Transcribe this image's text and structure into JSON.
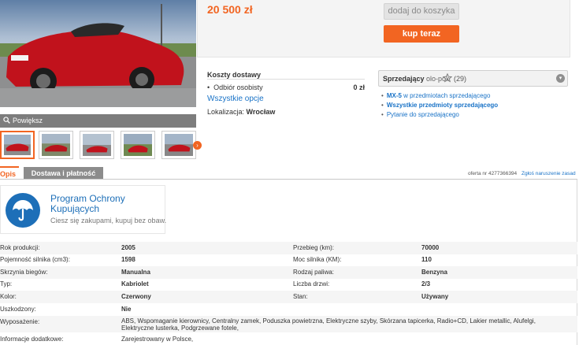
{
  "gallery": {
    "zoom_label": "Powiększ",
    "thumb_count": 5
  },
  "offer": {
    "price": "20 500 zł",
    "add_to_cart_label": "dodaj do koszyka",
    "buy_now_label": "kup teraz"
  },
  "shipping": {
    "title": "Koszty dostawy",
    "rows": [
      {
        "bullet": "•",
        "label": "Odbiór osobisty",
        "value": "0 zł"
      }
    ],
    "all_options_label": "Wszystkie opcje",
    "location_label": "Lokalizacja:",
    "location_value": "Wrocław"
  },
  "seller": {
    "label": "Sprzedający",
    "name": "olo-pok",
    "rating_count": "(29)",
    "toggle_icon": "▾",
    "links": [
      {
        "prefix": "MX-5",
        "text": " w przedmiotach sprzedającego",
        "bold": false
      },
      {
        "prefix": "",
        "text": "Wszystkie przedmioty sprzedającego",
        "bold": true
      },
      {
        "prefix": "",
        "text": "Pytanie do sprzedającego",
        "bold": false
      }
    ]
  },
  "tabs": [
    {
      "label": "Opis",
      "active": true
    },
    {
      "label": "Dostawa i płatność",
      "active": false
    }
  ],
  "offer_meta": {
    "offer_number": "oferta nr 4277366394",
    "report_label": "Zgłoś naruszenie zasad"
  },
  "protection": {
    "title": "Program Ochrony Kupujących",
    "subtitle": "Ciesz się zakupami, kupuj bez obaw."
  },
  "specs": [
    {
      "l1": "Rok produkcji:",
      "v1": "2005",
      "l2": "Przebieg (km):",
      "v2": "70000"
    },
    {
      "l1": "Pojemność silnika (cm3):",
      "v1": "1598",
      "l2": "Moc silnika (KM):",
      "v2": "110"
    },
    {
      "l1": "Skrzynia biegów:",
      "v1": "Manualna",
      "l2": "Rodzaj paliwa:",
      "v2": "Benzyna"
    },
    {
      "l1": "Typ:",
      "v1": "Kabriolet",
      "l2": "Liczba drzwi:",
      "v2": "2/3"
    },
    {
      "l1": "Kolor:",
      "v1": "Czerwony",
      "l2": "Stan:",
      "v2": "Używany"
    },
    {
      "l1": "Uszkodzony:",
      "v1": "Nie",
      "l2": "",
      "v2": ""
    },
    {
      "l1": "Wyposażenie:",
      "v1": "ABS, Wspomaganie kierownicy, Centralny zamek, Poduszka powietrzna, Elektryczne szyby, Skórzana tapicerka, Radio+CD, Lakier metallic, Alufelgi, Elektryczne lusterka, Podgrzewane fotele,",
      "l2": "",
      "v2": ""
    },
    {
      "l1": "Informacje dodatkowe:",
      "v1": "Zarejestrowany w Polsce,",
      "l2": "",
      "v2": ""
    }
  ],
  "colors": {
    "accent": "#f26522",
    "link": "#1a73c7",
    "protect_blue": "#1d6fb8"
  }
}
